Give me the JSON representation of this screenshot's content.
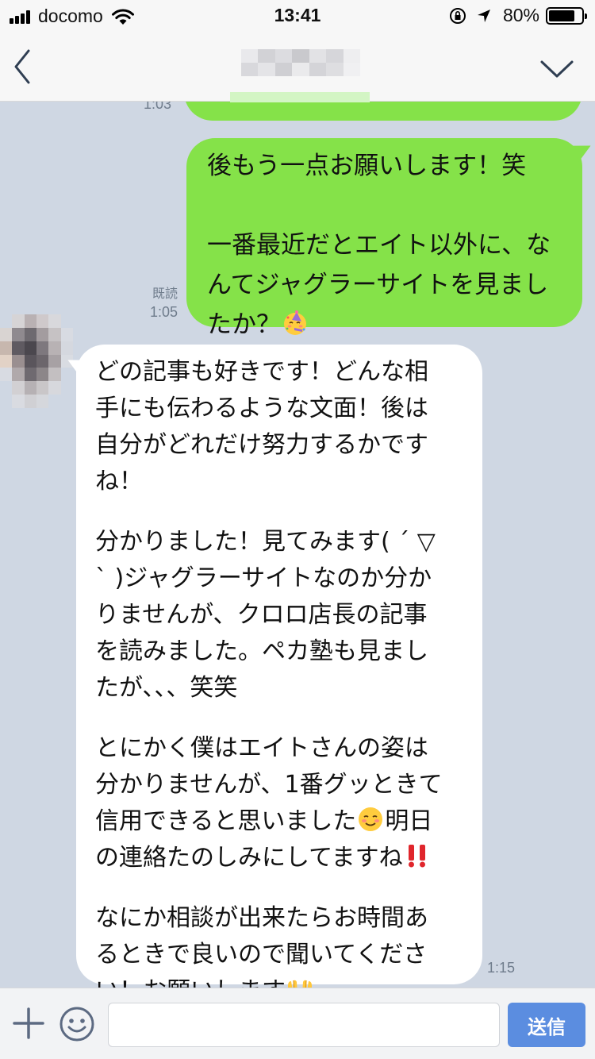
{
  "status_bar": {
    "carrier": "docomo",
    "time": "13:41",
    "battery_percent": "80%",
    "battery_level": 0.8
  },
  "header": {
    "chat_title": ""
  },
  "messages": {
    "partial_top": {
      "time": "1:03"
    },
    "outgoing": {
      "lines": [
        "後もう一点お願いします！笑",
        "",
        "一番最近だとエイト以外に、な",
        "んてジャグラーサイトを見まし",
        "たか？"
      ],
      "trailing_emoji": "partying-face-emoji",
      "read_label": "既読",
      "time": "1:05"
    },
    "incoming": {
      "p1": [
        "どの記事も好きです！どんな相",
        "手にも伝わるような文面！後は",
        "自分がどれだけ努力するかです",
        "ね！"
      ],
      "p2": [
        "分かりました！見てみます( ´ ▽",
        "` )ジャグラーサイトなのか分か",
        "りませんが、クロロ店長の記事",
        "を読みました。ペカ塾も見まし",
        "たが、、、笑笑"
      ],
      "p3_a": [
        "とにかく僕はエイトさんの姿は",
        "分かりませんが、1番グッときて"
      ],
      "p3_b_before": "信用できると思いました",
      "p3_b_after": "明日",
      "p3_c": "の連絡たのしみにしてますね",
      "p4": [
        "なにか相談が出来たらお時間あ",
        "るときで良いので聞いてくださ"
      ],
      "p4_last": "い！お願いします",
      "time": "1:15"
    }
  },
  "input_bar": {
    "placeholder": "",
    "send_label": "送信"
  },
  "colors": {
    "chat_background": "#cfd7e3",
    "outgoing_bubble": "#85e249",
    "incoming_bubble": "#ffffff",
    "send_button": "#5b8de0"
  },
  "icons": [
    "back-chevron-icon",
    "menu-chevron-down-icon",
    "plus-icon",
    "smiley-icon",
    "wifi-icon",
    "rotation-lock-icon",
    "location-arrow-icon",
    "battery-icon"
  ]
}
